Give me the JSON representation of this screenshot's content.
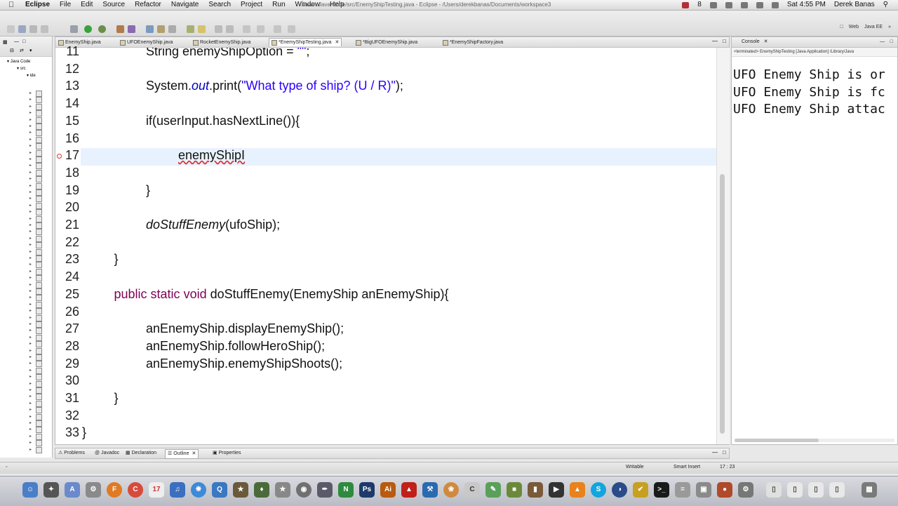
{
  "menubar": {
    "apple": "",
    "items": [
      "Eclipse",
      "File",
      "Edit",
      "Source",
      "Refactor",
      "Navigate",
      "Search",
      "Project",
      "Run",
      "Window",
      "Help"
    ],
    "window_title": "Java - Java Code/src/EnemyShipTesting.java - Eclipse - /Users/derekbanas/Documents/workspace3",
    "tray_badge": "8",
    "clock": "Sat 4:55 PM",
    "user": "Derek Banas"
  },
  "perspective": {
    "web": "Web",
    "java_ee": "Java EE"
  },
  "package_explorer": {
    "root": "Java Code",
    "src": "src",
    "pkg": "ide"
  },
  "editor": {
    "tabs": [
      {
        "label": "EnemyShip.java",
        "active": false
      },
      {
        "label": "UFOEnemyShip.java",
        "active": false
      },
      {
        "label": "RocketEnemyShip.java",
        "active": false
      },
      {
        "label": "*EnemyShipTesting.java",
        "active": true
      },
      {
        "label": "*BigUFOEnemyShip.java",
        "active": false
      },
      {
        "label": "*EnemyShipFactory.java",
        "active": false
      }
    ],
    "lines": [
      {
        "num": "11",
        "text": "String enemyShipOption = \"\";"
      },
      {
        "num": "12",
        "text": ""
      },
      {
        "num": "13",
        "text": "System.out.print(\"What type of ship? (U / R)\");"
      },
      {
        "num": "14",
        "text": ""
      },
      {
        "num": "15",
        "text": "if(userInput.hasNextLine()){"
      },
      {
        "num": "16",
        "text": ""
      },
      {
        "num": "17",
        "text": "enemyShipI"
      },
      {
        "num": "18",
        "text": ""
      },
      {
        "num": "19",
        "text": "}"
      },
      {
        "num": "20",
        "text": ""
      },
      {
        "num": "21",
        "text": "doStuffEnemy(ufoShip);"
      },
      {
        "num": "22",
        "text": ""
      },
      {
        "num": "23",
        "text": "}"
      },
      {
        "num": "24",
        "text": ""
      },
      {
        "num": "25",
        "text": "public static void doStuffEnemy(EnemyShip anEnemyShip){"
      },
      {
        "num": "26",
        "text": ""
      },
      {
        "num": "27",
        "text": "anEnemyShip.displayEnemyShip();"
      },
      {
        "num": "28",
        "text": "anEnemyShip.followHeroShip();"
      },
      {
        "num": "29",
        "text": "anEnemyShip.enemyShipShoots();"
      },
      {
        "num": "30",
        "text": ""
      },
      {
        "num": "31",
        "text": "}"
      },
      {
        "num": "32",
        "text": ""
      },
      {
        "num": "33",
        "text": "}"
      }
    ]
  },
  "console": {
    "title": "Console",
    "subtitle": "<terminated> EnemyShipTesting [Java Application] /Library/Java",
    "lines": [
      "UFO Enemy Ship is or",
      "UFO Enemy Ship is fc",
      "UFO Enemy Ship attac"
    ]
  },
  "bottom_tabs": [
    {
      "label": "Problems",
      "active": false
    },
    {
      "label": "Javadoc",
      "active": false
    },
    {
      "label": "Declaration",
      "active": false
    },
    {
      "label": "Outline",
      "active": true
    },
    {
      "label": "Properties",
      "active": false
    }
  ],
  "status": {
    "writable": "Writable",
    "insert_mode": "Smart Insert",
    "position": "17 : 23"
  },
  "colors": {
    "keyword": "#7f0055",
    "string": "#2a00ff",
    "current_line": "#e8f2fe"
  }
}
